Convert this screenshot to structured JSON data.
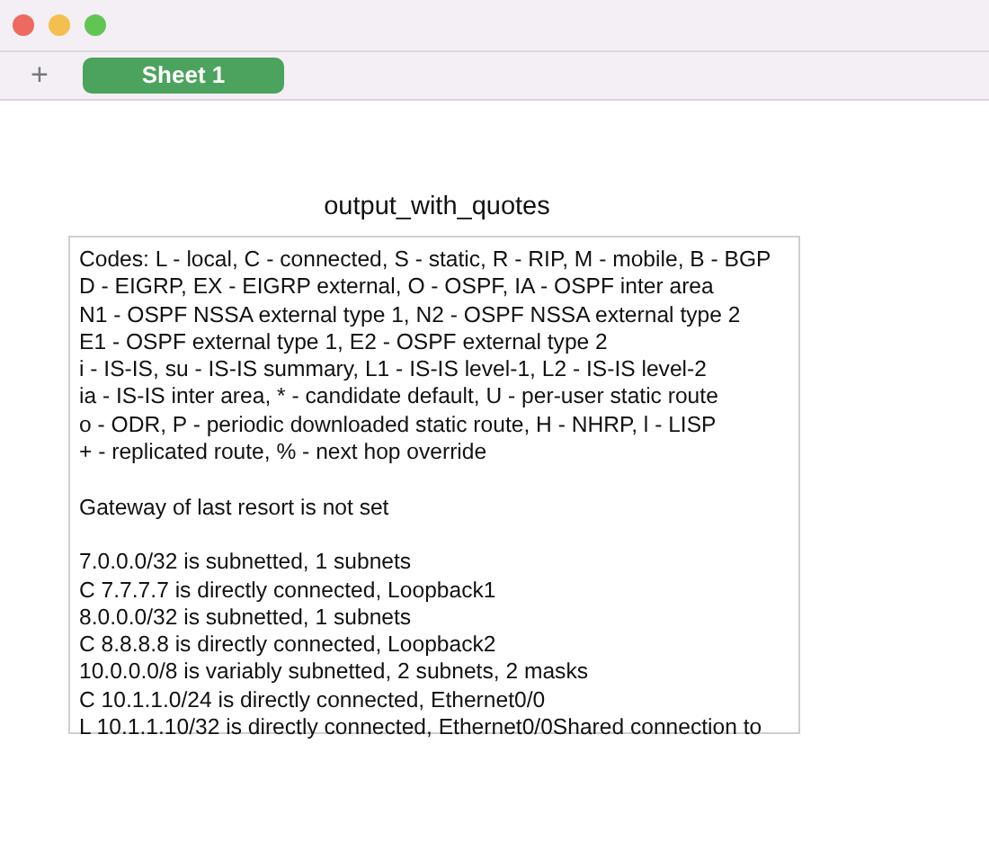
{
  "window": {
    "controls": [
      {
        "color": "#ed6a5e"
      },
      {
        "color": "#f5bf4f"
      },
      {
        "color": "#61c554"
      }
    ]
  },
  "tab_bar": {
    "add_label": "+",
    "tabs": [
      {
        "label": "Sheet 1",
        "selected": true
      }
    ]
  },
  "sheet": {
    "title": "output_with_quotes",
    "text_groups": [
      [
        "Codes: L - local, C - connected, S - static, R - RIP, M - mobile, B - BGP",
        "D - EIGRP, EX - EIGRP external, O - OSPF, IA - OSPF inter area",
        "N1 - OSPF NSSA external type 1, N2 - OSPF NSSA external type 2",
        "E1 - OSPF external type 1, E2 - OSPF external type 2",
        "i - IS-IS, su - IS-IS summary, L1 - IS-IS level-1, L2 - IS-IS level-2",
        "ia - IS-IS inter area, * - candidate default, U - per-user static route",
        "o - ODR, P - periodic downloaded static route, H - NHRP, l - LISP",
        "+ - replicated route, % - next hop override"
      ],
      [
        "Gateway of last resort is not set"
      ],
      [
        "7.0.0.0/32 is subnetted, 1 subnets",
        "C 7.7.7.7 is directly connected, Loopback1",
        "8.0.0.0/32 is subnetted, 1 subnets",
        "C 8.8.8.8 is directly connected, Loopback2",
        "10.0.0.0/8 is variably subnetted, 2 subnets, 2 masks",
        "C 10.1.1.0/24 is directly connected, Ethernet0/0",
        "L 10.1.1.10/32 is directly connected, Ethernet0/0Shared connection to"
      ]
    ]
  }
}
